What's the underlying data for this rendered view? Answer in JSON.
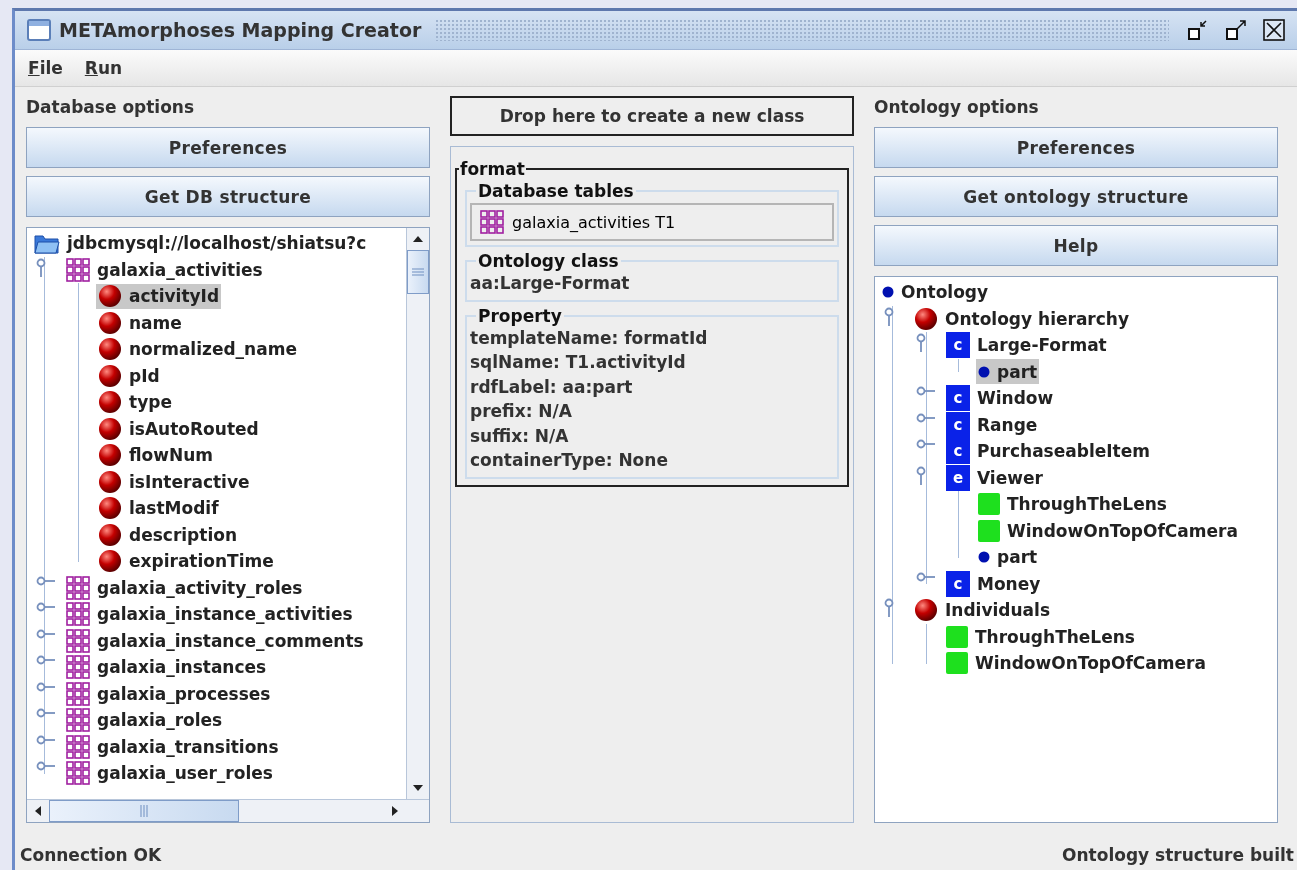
{
  "window": {
    "title": "METAmorphoses Mapping Creator"
  },
  "menu": [
    {
      "label": "File"
    },
    {
      "label": "Run"
    }
  ],
  "database_panel": {
    "heading": "Database options",
    "buttons": [
      "Preferences",
      "Get DB structure"
    ],
    "tree": [
      {
        "label": "jdbcmysql://localhost/shiatsu?c",
        "kind": "database",
        "selected": false,
        "children": [
          {
            "label": "galaxia_activities",
            "kind": "table",
            "expanded": true,
            "selected": false,
            "children": [
              {
                "label": "activityId",
                "kind": "column",
                "selected": true
              },
              {
                "label": "name",
                "kind": "column",
                "selected": false
              },
              {
                "label": "normalized_name",
                "kind": "column",
                "selected": false
              },
              {
                "label": "pId",
                "kind": "column",
                "selected": false
              },
              {
                "label": "type",
                "kind": "column",
                "selected": false
              },
              {
                "label": "isAutoRouted",
                "kind": "column",
                "selected": false
              },
              {
                "label": "flowNum",
                "kind": "column",
                "selected": false
              },
              {
                "label": "isInteractive",
                "kind": "column",
                "selected": false
              },
              {
                "label": "lastModif",
                "kind": "column",
                "selected": false
              },
              {
                "label": "description",
                "kind": "column",
                "selected": false
              },
              {
                "label": "expirationTime",
                "kind": "column",
                "selected": false
              }
            ]
          },
          {
            "label": "galaxia_activity_roles",
            "kind": "table",
            "expanded": false,
            "selected": false
          },
          {
            "label": "galaxia_instance_activities",
            "kind": "table",
            "expanded": false,
            "selected": false
          },
          {
            "label": "galaxia_instance_comments",
            "kind": "table",
            "expanded": false,
            "selected": false
          },
          {
            "label": "galaxia_instances",
            "kind": "table",
            "expanded": false,
            "selected": false
          },
          {
            "label": "galaxia_processes",
            "kind": "table",
            "expanded": false,
            "selected": false
          },
          {
            "label": "galaxia_roles",
            "kind": "table",
            "expanded": false,
            "selected": false
          },
          {
            "label": "galaxia_transitions",
            "kind": "table",
            "expanded": false,
            "selected": false
          },
          {
            "label": "galaxia_user_roles",
            "kind": "table",
            "expanded": false,
            "selected": false
          }
        ]
      }
    ]
  },
  "mapping_panel": {
    "drop_target": "Drop here to create a new class",
    "title": "format",
    "database_tables": {
      "heading": "Database tables",
      "items": [
        {
          "label": "galaxia_activities T1"
        }
      ]
    },
    "ontology_class": {
      "heading": "Ontology class",
      "value": "aa:Large-Format"
    },
    "property": {
      "heading": "Property",
      "lines": [
        "templateName: formatId",
        "sqlName: T1.activityId",
        "rdfLabel: aa:part",
        "prefix: N/A",
        "suffix: N/A",
        "containerType: None"
      ]
    }
  },
  "ontology_panel": {
    "heading": "Ontology options",
    "buttons": [
      "Preferences",
      "Get ontology structure",
      "Help"
    ],
    "tree": [
      {
        "label": "Ontology",
        "kind": "dot",
        "selected": false,
        "children": [
          {
            "label": "Ontology hierarchy",
            "kind": "ball",
            "expanded": true,
            "selected": false,
            "children": [
              {
                "label": "Large-Format",
                "kind": "class",
                "badge": "c",
                "expanded": true,
                "selected": false,
                "children": [
                  {
                    "label": "part",
                    "kind": "dot",
                    "selected": true
                  }
                ]
              },
              {
                "label": "Window",
                "kind": "class",
                "badge": "c",
                "expanded": false,
                "selected": false
              },
              {
                "label": "Range",
                "kind": "class",
                "badge": "c",
                "expanded": false,
                "selected": false
              },
              {
                "label": "PurchaseableItem",
                "kind": "class",
                "badge": "c",
                "expanded": false,
                "selected": false
              },
              {
                "label": "Viewer",
                "kind": "class",
                "badge": "e",
                "expanded": true,
                "selected": false,
                "children": [
                  {
                    "label": "ThroughTheLens",
                    "kind": "individual",
                    "selected": false
                  },
                  {
                    "label": "WindowOnTopOfCamera",
                    "kind": "individual",
                    "selected": false
                  },
                  {
                    "label": "part",
                    "kind": "dot",
                    "selected": false
                  }
                ]
              },
              {
                "label": "Money",
                "kind": "class",
                "badge": "c",
                "expanded": false,
                "selected": false
              }
            ]
          },
          {
            "label": "Individuals",
            "kind": "ball",
            "expanded": true,
            "selected": false,
            "children": [
              {
                "label": "ThroughTheLens",
                "kind": "individual",
                "selected": false
              },
              {
                "label": "WindowOnTopOfCamera",
                "kind": "individual",
                "selected": false
              }
            ]
          }
        ]
      }
    ]
  },
  "status_bar": {
    "left": "Connection OK",
    "right": "Ontology structure built"
  }
}
